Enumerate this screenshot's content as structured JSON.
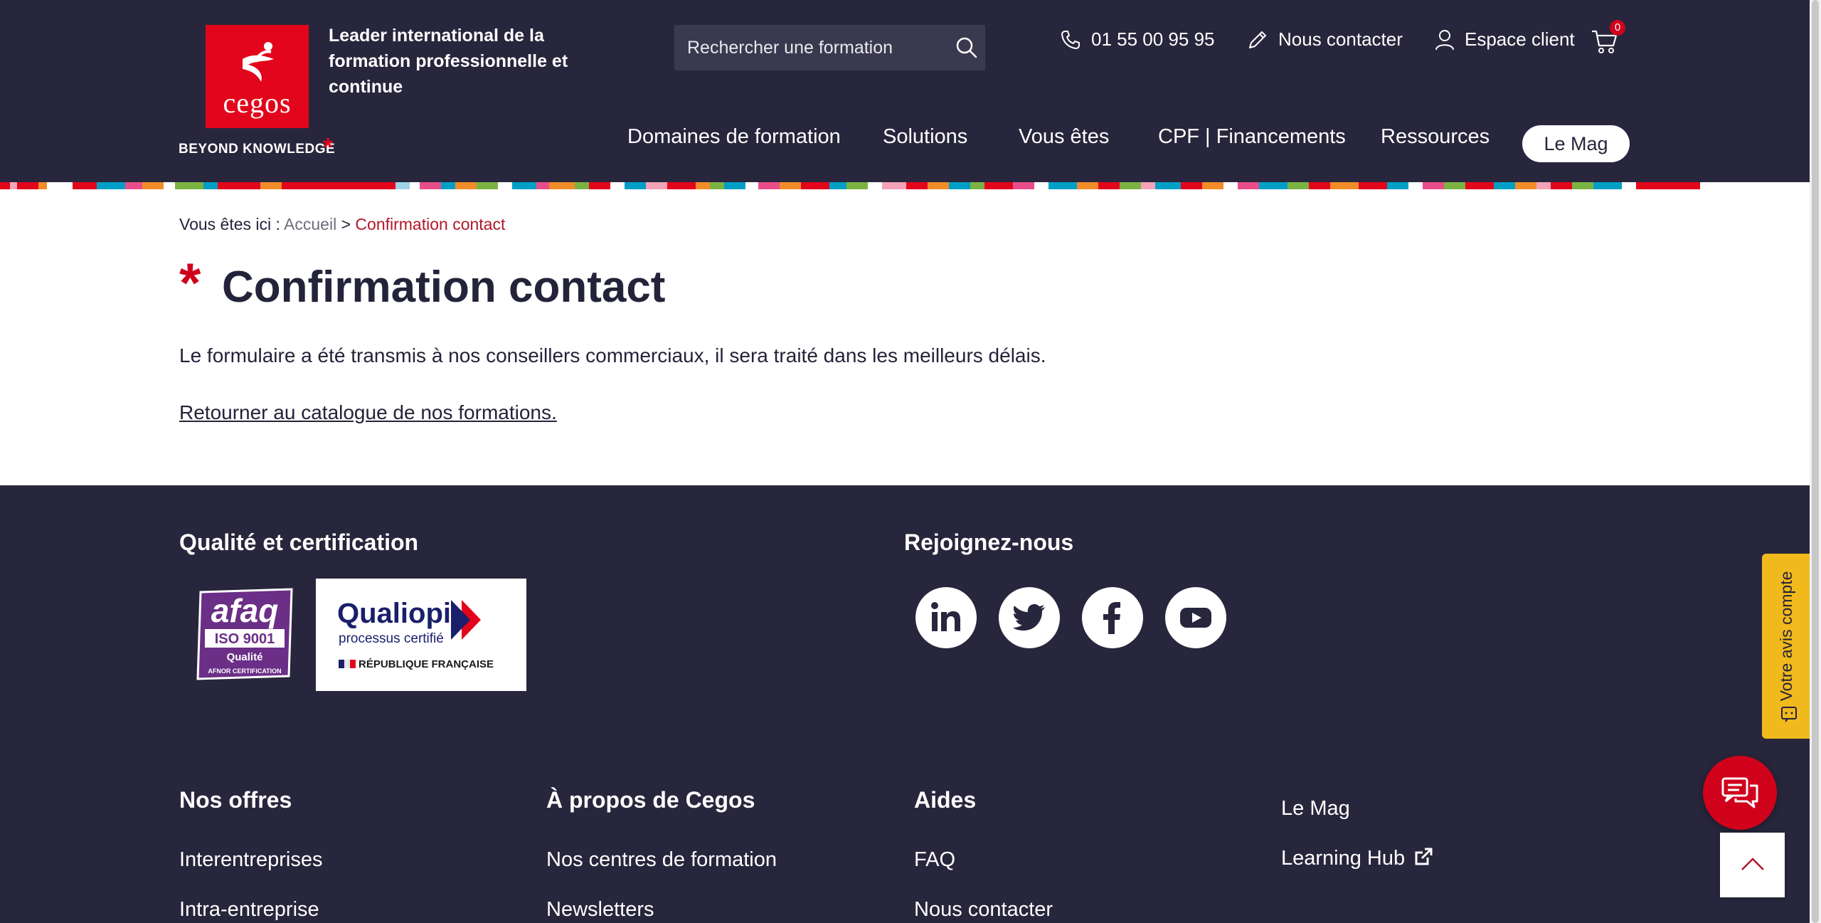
{
  "header": {
    "logo_word": "cegos",
    "logo_tagline": "BEYOND KNOWLEDGE",
    "baseline": "Leader international de la formation professionnelle et continue",
    "search_placeholder": "Rechercher une formation",
    "phone": "01 55 00 95 95",
    "contact": "Nous contacter",
    "client_space": "Espace client",
    "cart_count": "0",
    "nav": [
      "Domaines de formation",
      "Solutions",
      "Vous êtes",
      "CPF | Financements",
      "Ressources"
    ],
    "mag_button": "Le Mag"
  },
  "breadcrumb": {
    "prefix": "Vous êtes ici :",
    "home": "Accueil",
    "separator": ">",
    "current": "Confirmation contact"
  },
  "main": {
    "title": "Confirmation contact",
    "message": "Le formulaire a été transmis à nos conseillers commerciaux, il sera traité dans les meilleurs délais.",
    "back_link": "Retourner au catalogue de nos formations."
  },
  "footer": {
    "quality_heading": "Qualité et certification",
    "join_heading": "Rejoignez-nous",
    "afaq": {
      "brand": "afaq",
      "norm": "ISO 9001",
      "label": "Qualité",
      "org": "AFNOR CERTIFICATION"
    },
    "qualiopi": {
      "brand": "Qualiopi",
      "sub": "processus certifié",
      "country": "RÉPUBLIQUE FRANÇAISE"
    },
    "socials": [
      "linkedin-icon",
      "twitter-icon",
      "facebook-icon",
      "youtube-icon"
    ],
    "columns": [
      {
        "heading": "Nos offres",
        "links": [
          "Interentreprises",
          "Intra-entreprise"
        ]
      },
      {
        "heading": "À propos de Cegos",
        "links": [
          "Nos centres de formation",
          "Newsletters"
        ]
      },
      {
        "heading": "Aides",
        "links": [
          "FAQ",
          "Nous contacter"
        ]
      },
      {
        "heading": "",
        "links": [
          "Le Mag",
          "Learning Hub"
        ]
      }
    ]
  },
  "floating": {
    "review_tab": "Votre avis compte"
  },
  "colors": {
    "header_bg": "#27263c",
    "brand_red": "#e3051b",
    "review_tab": "#f1b91c"
  }
}
